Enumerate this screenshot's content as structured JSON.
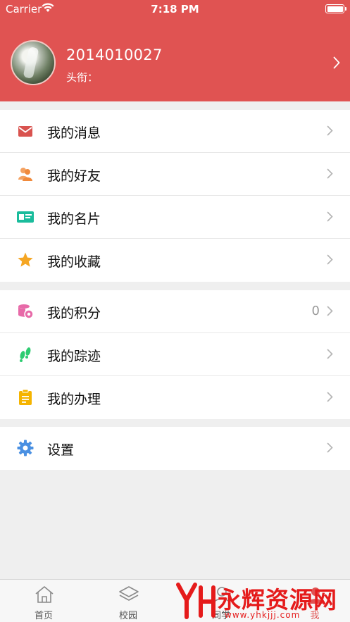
{
  "status_bar": {
    "carrier": "Carrier",
    "time": "7:18 PM"
  },
  "profile": {
    "user_id": "2014010027",
    "title_label": "头衔："
  },
  "menu_groups": [
    [
      {
        "label": "我的消息",
        "icon": "mail-icon",
        "color": "#d9534f"
      },
      {
        "label": "我的好友",
        "icon": "friends-icon",
        "color": "#f08a3c"
      },
      {
        "label": "我的名片",
        "icon": "card-icon",
        "color": "#1abc9c"
      },
      {
        "label": "我的收藏",
        "icon": "star-icon",
        "color": "#f5a623"
      }
    ],
    [
      {
        "label": "我的积分",
        "icon": "coins-icon",
        "color": "#e76aa8",
        "value": "0"
      },
      {
        "label": "我的踪迹",
        "icon": "footprints-icon",
        "color": "#2ecc71"
      },
      {
        "label": "我的办理",
        "icon": "clipboard-icon",
        "color": "#f5b400"
      }
    ],
    [
      {
        "label": "设置",
        "icon": "gear-icon",
        "color": "#4a90e2"
      }
    ]
  ],
  "tabs": [
    {
      "label": "首页",
      "icon": "home-icon"
    },
    {
      "label": "校园",
      "icon": "layers-icon"
    },
    {
      "label": "同学",
      "icon": "classmates-icon"
    },
    {
      "label": "我",
      "icon": "profile-icon"
    }
  ],
  "watermark": {
    "brand": "永辉资源网",
    "url": "www.yhkjjj.com"
  },
  "colors": {
    "header": "#e05352",
    "background": "#efefef",
    "accent": "#e05352"
  }
}
